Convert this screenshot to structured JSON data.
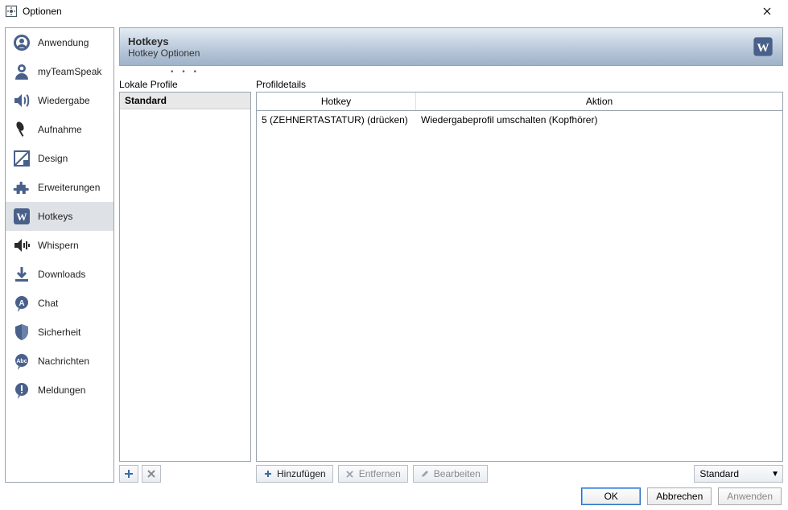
{
  "window": {
    "title": "Optionen",
    "close_icon": "close-icon"
  },
  "sidebar": {
    "items": [
      {
        "icon": "application",
        "label": "Anwendung"
      },
      {
        "icon": "myteamspeak",
        "label": "myTeamSpeak"
      },
      {
        "icon": "playback",
        "label": "Wiedergabe"
      },
      {
        "icon": "capture",
        "label": "Aufnahme"
      },
      {
        "icon": "design",
        "label": "Design"
      },
      {
        "icon": "addons",
        "label": "Erweiterungen"
      },
      {
        "icon": "hotkeys",
        "label": "Hotkeys",
        "selected": true
      },
      {
        "icon": "whisper",
        "label": "Whispern"
      },
      {
        "icon": "downloads",
        "label": "Downloads"
      },
      {
        "icon": "chat",
        "label": "Chat"
      },
      {
        "icon": "security",
        "label": "Sicherheit"
      },
      {
        "icon": "messages",
        "label": "Nachrichten"
      },
      {
        "icon": "notifications",
        "label": "Meldungen"
      }
    ]
  },
  "header": {
    "title": "Hotkeys",
    "subtitle": "Hotkey Optionen"
  },
  "profiles": {
    "section_label": "Lokale Profile",
    "items": [
      {
        "name": "Standard"
      }
    ],
    "add_tooltip": "add",
    "delete_tooltip": "delete"
  },
  "details": {
    "section_label": "Profildetails",
    "columns": {
      "hotkey": "Hotkey",
      "action": "Aktion"
    },
    "rows": [
      {
        "hotkey": "5 (ZEHNERTASTATUR) (drücken)",
        "action": "Wiedergabeprofil umschalten (Kopfhörer)"
      }
    ],
    "buttons": {
      "add": "Hinzufügen",
      "remove": "Entfernen",
      "edit": "Bearbeiten"
    },
    "combo_value": "Standard"
  },
  "footer": {
    "ok": "OK",
    "cancel": "Abbrechen",
    "apply": "Anwenden"
  }
}
